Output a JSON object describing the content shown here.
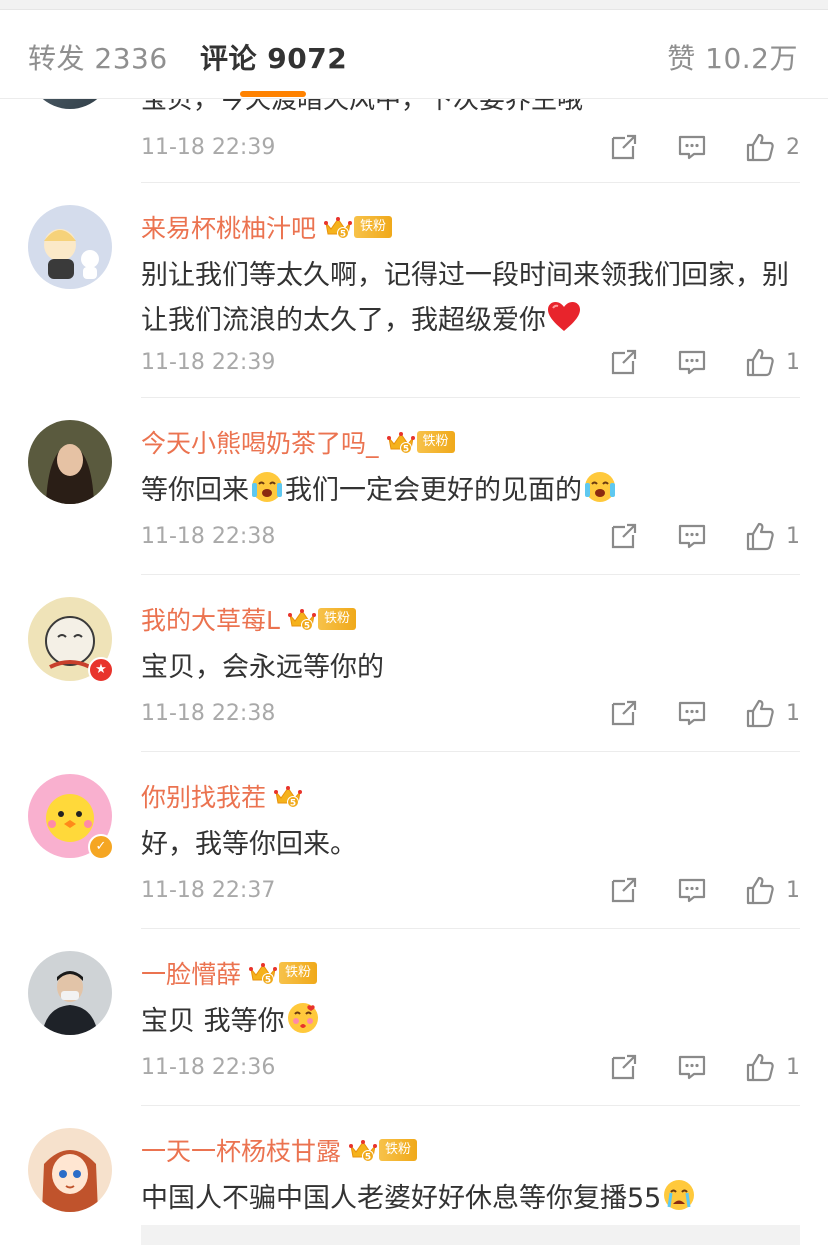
{
  "tabs": {
    "repost": "转发 2336",
    "comment": "评论 9072",
    "like": "赞 10.2万"
  },
  "partial_comment": {
    "text": "宝贝，今天渡暗天风中，下次要养生哦",
    "time": "11-18 22:39",
    "likes": "2"
  },
  "comments": [
    {
      "user": "来易杯桃柚汁吧",
      "fan_label": "铁粉",
      "text": "别让我们等太久啊，记得过一段时间来领我们回家，别让我们流浪的太久了，我超级爱你",
      "emoji": "heart-emoji",
      "time": "11-18 22:39",
      "likes": "1",
      "avatar_color": "#c9d4e8"
    },
    {
      "user": "今天小熊喝奶茶了吗_",
      "fan_label": "铁粉",
      "text_a": "等你回来",
      "text_b": "我们一定会更好的见面的",
      "emoji": "crying-cheer-emoji",
      "time": "11-18 22:38",
      "likes": "1",
      "avatar_color": "#4a3f35"
    },
    {
      "user": "我的大草莓L",
      "fan_label": "铁粉",
      "text": "宝贝，会永远等你的",
      "time": "11-18 22:38",
      "likes": "1",
      "avatar_color": "#e8d9a8"
    },
    {
      "user": "你别找我茬",
      "text": "好，我等你回来。",
      "time": "11-18 22:37",
      "likes": "1",
      "avatar_color": "#f7a8c8"
    },
    {
      "user": "一脸懵薛",
      "fan_label": "铁粉",
      "text": "宝贝 我等你",
      "emoji": "kiss-emoji",
      "time": "11-18 22:36",
      "likes": "1",
      "avatar_color": "#3a4450"
    },
    {
      "user": "一天一杯杨枝甘露",
      "fan_label": "铁粉",
      "text": "中国人不骗中国人老婆好好休息等你复播55",
      "emoji": "sob-emoji",
      "avatar_color": "#f3c9a8"
    }
  ],
  "colors": {
    "accent": "#ff8200",
    "username": "#eb7350",
    "fan_badge": "#f0a91a"
  }
}
